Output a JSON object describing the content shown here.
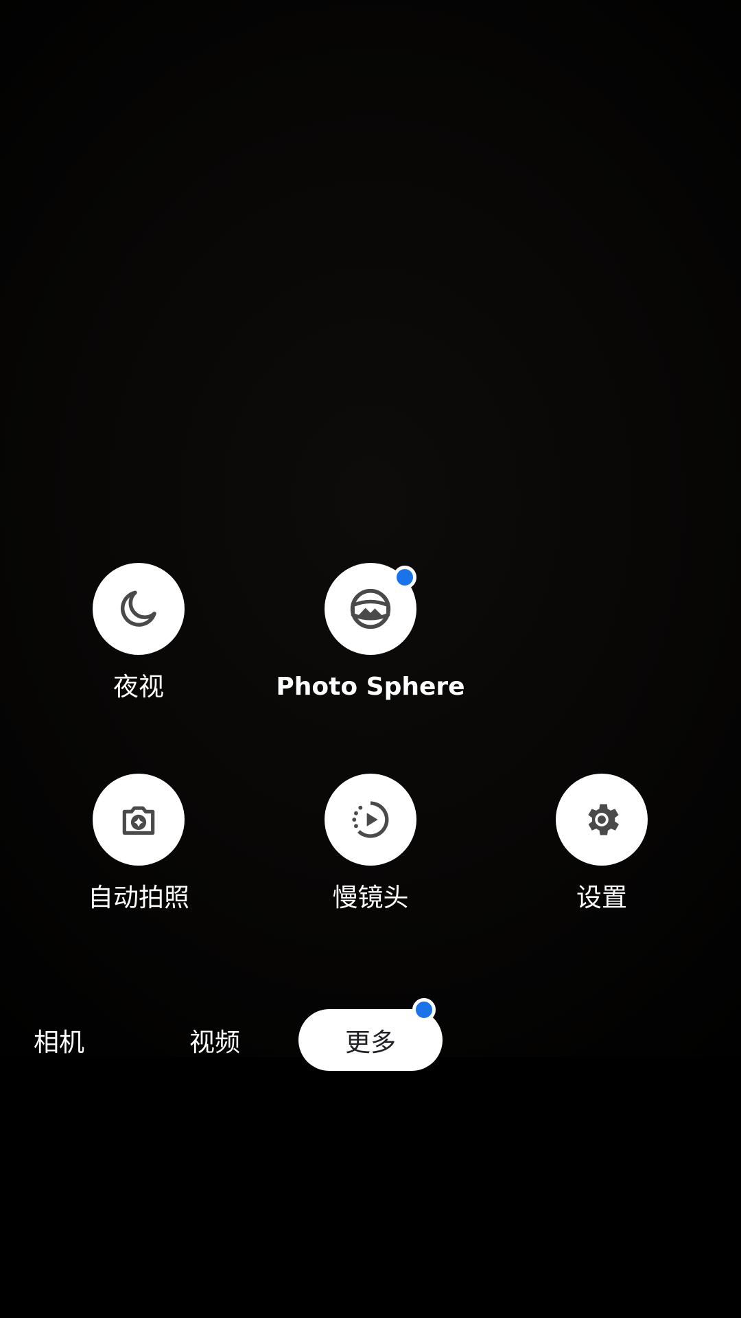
{
  "modes": {
    "night": {
      "label": "夜视",
      "icon": "moon-icon"
    },
    "photo_sphere": {
      "label": "Photo Sphere",
      "icon": "photo-sphere-icon",
      "has_new_badge": true
    },
    "auto_shot": {
      "label": "自动拍照",
      "icon": "auto-camera-icon"
    },
    "slow_motion": {
      "label": "慢镜头",
      "icon": "slow-motion-icon"
    },
    "settings": {
      "label": "设置",
      "icon": "gear-icon"
    }
  },
  "tabs": {
    "camera": "相机",
    "video": "视频",
    "more": "更多",
    "active": "more",
    "more_has_badge": true
  },
  "colors": {
    "badge": "#1a73e8",
    "icon": "#4a4a4a",
    "circle": "#ffffff"
  }
}
